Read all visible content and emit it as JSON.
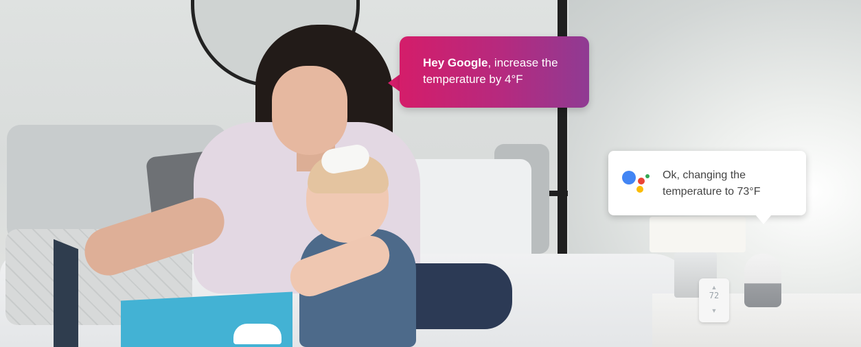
{
  "speech": {
    "user_strong": "Hey Google",
    "user_rest": ", increase the temperature by 4°F",
    "assistant_reply": "Ok, changing the temperature to 73°F"
  },
  "thermostat": {
    "display": "72"
  },
  "colors": {
    "user_bubble_start": "#d41d6a",
    "user_bubble_end": "#8f3b93",
    "assistant_bubble": "#ffffff",
    "assistant_dot_blue": "#4285f4",
    "assistant_dot_red": "#ea4335",
    "assistant_dot_yellow": "#fbbc05",
    "assistant_dot_green": "#34a853"
  },
  "icons": [
    "google-assistant-icon",
    "thermostat-chevron-up-icon",
    "thermostat-chevron-down-icon"
  ]
}
